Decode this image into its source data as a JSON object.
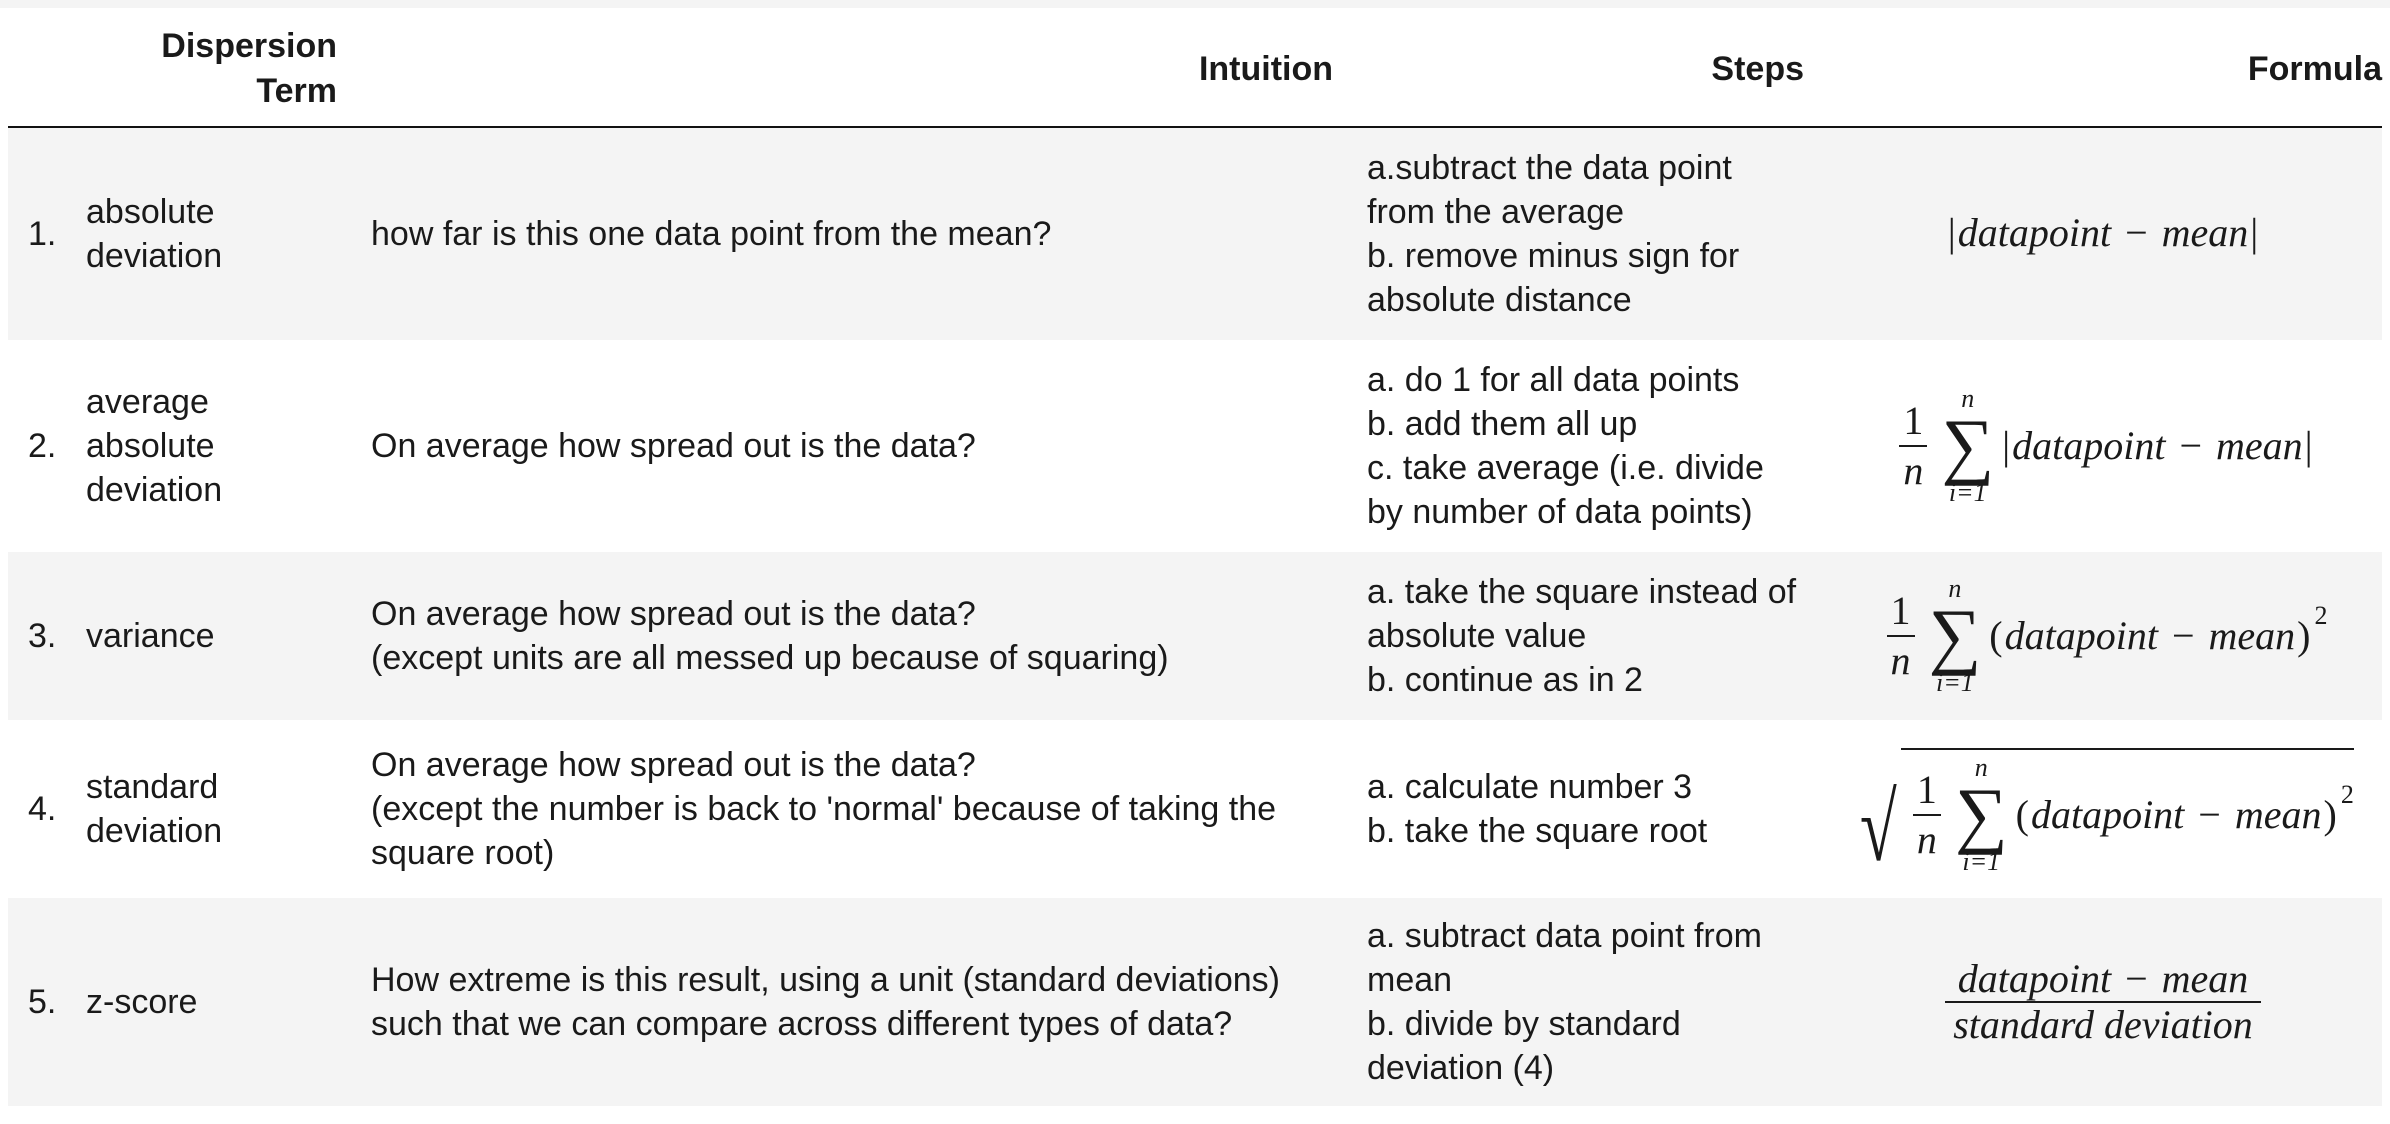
{
  "headers": {
    "term": "Dispersion Term",
    "intuition": "Intuition",
    "steps": "Steps",
    "formula": "Formula"
  },
  "rows": [
    {
      "index": "1.",
      "term": "absolute deviation",
      "intuition": [
        "how far is this one data point from the mean?"
      ],
      "steps": [
        "a.subtract the data point from the average",
        "b. remove minus sign for absolute distance"
      ]
    },
    {
      "index": "2.",
      "term": "average absolute deviation",
      "intuition": [
        "On average how spread out is the data?"
      ],
      "steps": [
        "a. do 1 for all data points",
        "b. add them all up",
        "c. take average (i.e. divide by number of data points)"
      ]
    },
    {
      "index": "3.",
      "term": "variance",
      "intuition": [
        "On average how spread out is the data?",
        "(except units are all messed up because of squaring)"
      ],
      "steps": [
        "a. take the square instead of absolute value",
        "b. continue as in 2"
      ]
    },
    {
      "index": "4.",
      "term": "standard deviation",
      "intuition": [
        "On average how spread out is the data?",
        "(except the number is back to 'normal' because of taking the square root)"
      ],
      "steps": [
        "a. calculate number 3",
        "b. take the square root"
      ]
    },
    {
      "index": "5.",
      "term": "z-score",
      "intuition": [
        "How extreme is this result, using a unit (standard deviations) such that we can compare across different types of data?"
      ],
      "steps": [
        "a. subtract data point from mean",
        "b. divide by standard deviation (4)"
      ]
    }
  ],
  "math": {
    "datapoint": "datapoint",
    "minus": "−",
    "mean": "mean",
    "bar": "|",
    "one": "1",
    "n": "n",
    "lower": "i=1",
    "sigma": "∑",
    "lparen": "(",
    "rparen": ")",
    "two": "2",
    "radical": "√",
    "stddev": "standard deviation"
  }
}
